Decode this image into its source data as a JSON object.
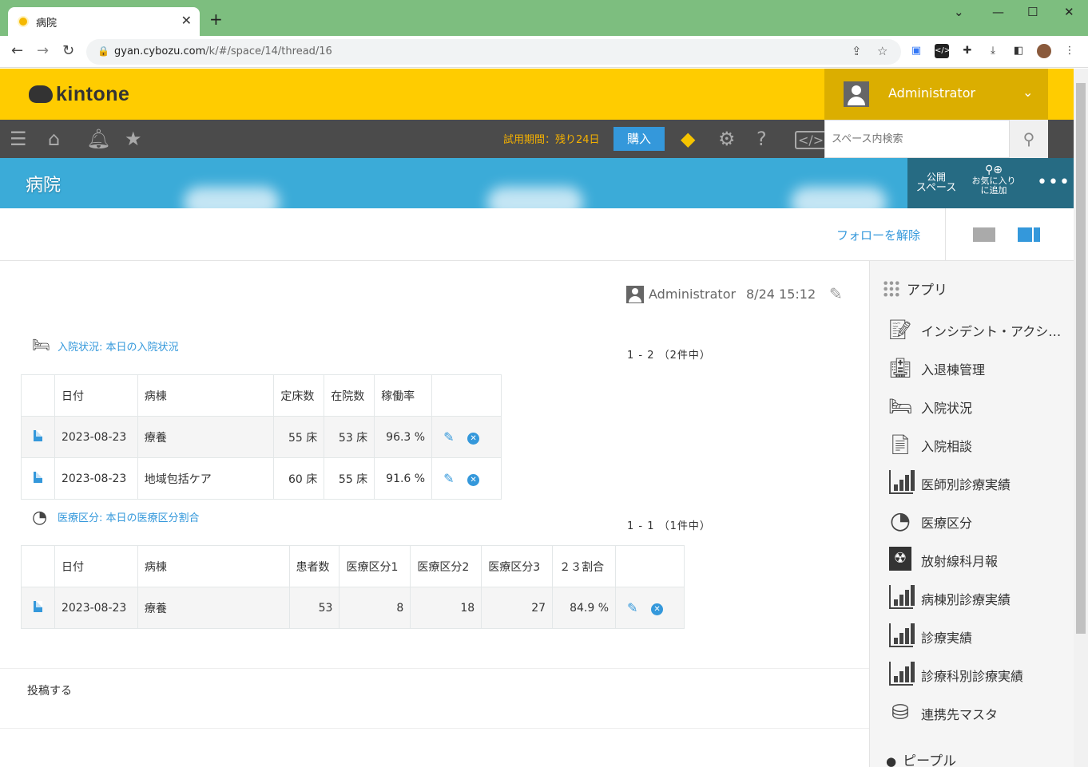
{
  "browser": {
    "tab_title": "病院",
    "url_host": "gyan.cybozu.com",
    "url_path": "/k/#/space/14/thread/16",
    "colors": {
      "tabbar": "#7dbe7f"
    }
  },
  "header": {
    "logo_text": "kintone",
    "user_name": "Administrator",
    "trial_text": "試用期間：残り24日",
    "buy_label": "購入",
    "search_placeholder": "スペース内検索",
    "colors": {
      "brand_yellow": "#ffcc00",
      "toolbar": "#4b4b4b",
      "accent_blue": "#3498db"
    }
  },
  "space": {
    "title": "病院",
    "public_label_1": "公開",
    "public_label_2": "スペース",
    "favorite_label_1": "お気に入り",
    "favorite_label_2": "に追加",
    "unfollow_label": "フォローを解除"
  },
  "post": {
    "author": "Administrator",
    "time": "8/24 15:12",
    "post_label": "投稿する"
  },
  "embed1": {
    "title": "入院状況: 本日の入院状況",
    "pager": "1 - 2 （2件中）",
    "headers": [
      "日付",
      "病棟",
      "定床数",
      "在院数",
      "稼働率"
    ],
    "rows": [
      [
        "2023-08-23",
        "療養",
        "55 床",
        "53 床",
        "96.3 %"
      ],
      [
        "2023-08-23",
        "地域包括ケア",
        "60 床",
        "55 床",
        "91.6 %"
      ]
    ]
  },
  "embed2": {
    "title": "医療区分: 本日の医療区分割合",
    "pager": "1 - 1 （1件中）",
    "headers": [
      "日付",
      "病棟",
      "患者数",
      "医療区分1",
      "医療区分2",
      "医療区分3",
      "２３割合"
    ],
    "rows": [
      [
        "2023-08-23",
        "療養",
        "53",
        "8",
        "18",
        "27",
        "84.9 %"
      ]
    ]
  },
  "sidebar": {
    "apps_heading": "アプリ",
    "apps": [
      {
        "label": "インシデント・アクシデント",
        "icon": "document-edit-icon"
      },
      {
        "label": "入退棟管理",
        "icon": "hospital-icon"
      },
      {
        "label": "入院状況",
        "icon": "bed-icon"
      },
      {
        "label": "入院相談",
        "icon": "document-icon"
      },
      {
        "label": "医師別診療実績",
        "icon": "bar-chart-icon"
      },
      {
        "label": "医療区分",
        "icon": "pie-chart-icon"
      },
      {
        "label": "放射線科月報",
        "icon": "radiology-icon"
      },
      {
        "label": "病棟別診療実績",
        "icon": "bar-chart-icon"
      },
      {
        "label": "診療実績",
        "icon": "bar-chart-icon"
      },
      {
        "label": "診療科別診療実績",
        "icon": "bar-chart-icon"
      },
      {
        "label": "連携先マスタ",
        "icon": "database-icon"
      }
    ],
    "people_heading": "ピープル"
  }
}
